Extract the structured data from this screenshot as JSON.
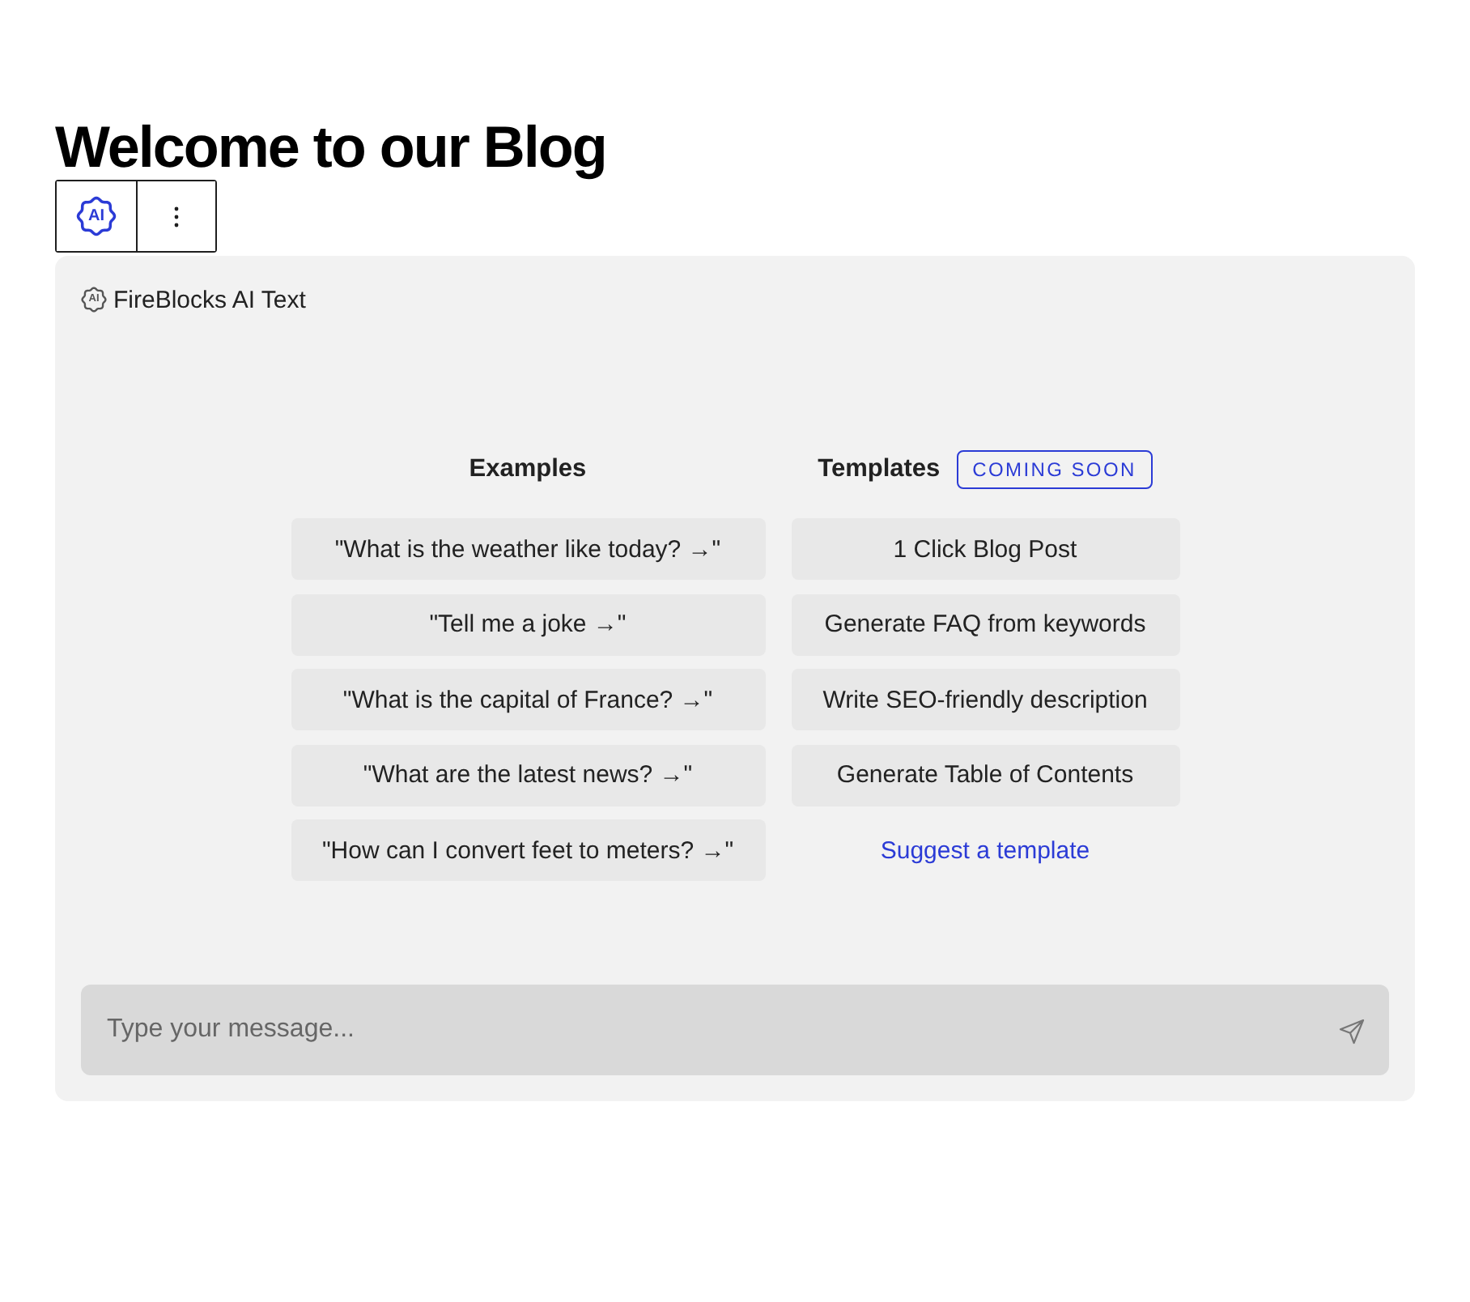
{
  "heading": "Welcome to our Blog",
  "toolbar": {
    "ai_label": "AI"
  },
  "panel": {
    "icon_label": "AI",
    "title": "FireBlocks AI Text"
  },
  "examples": {
    "heading": "Examples",
    "items": [
      "\"What is the weather like today? →\"",
      "\"Tell me a joke →\"",
      "\"What is the capital of France? →\"",
      "\"What are the latest news? →\"",
      "\"How can I convert feet to meters? →\""
    ]
  },
  "templates": {
    "heading": "Templates",
    "badge": "COMING SOON",
    "items": [
      "1 Click Blog Post",
      "Generate FAQ from keywords",
      "Write SEO-friendly description",
      "Generate Table of Contents"
    ],
    "link": "Suggest a template"
  },
  "composer": {
    "placeholder": "Type your message..."
  }
}
